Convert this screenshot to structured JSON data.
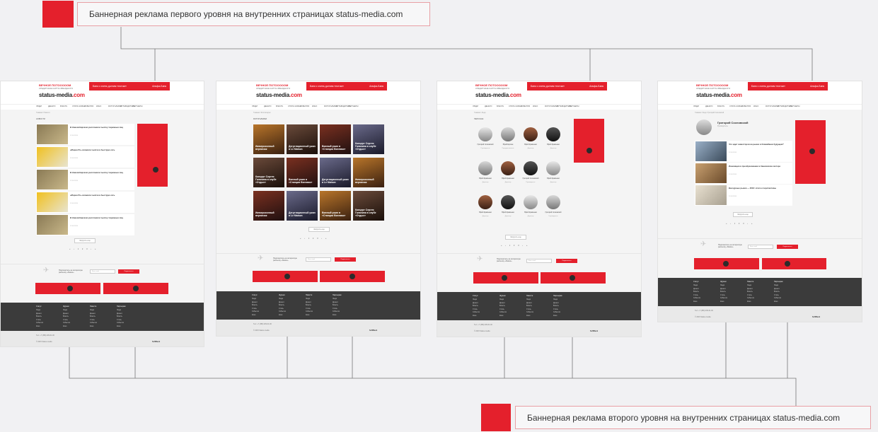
{
  "top_callout": {
    "text": "Баннерная реклама первого уровня на внутренних страницах status-media.com"
  },
  "bottom_callout": {
    "text": "Баннерная реклама второго уровня на внутренних страницах status-media.com"
  },
  "colors": {
    "accent": "#e4202c",
    "footer": "#3b3b3b",
    "background": "#f1f1f3"
  },
  "site": {
    "logo_main": "status-media",
    "logo_tld": ".com",
    "promo_line1": "ВЕЧНОЕ ПОТОООООМ",
    "promo_line2": "КРЕДИТНЫЕ КАРТЫ ЗВЕЗДНОГО",
    "banner_text": "Банк с очень долгим «потом»",
    "banner_brand": "Альфа-Банк",
    "nav": [
      "ЛЮДИ",
      "ДЕНЬГИ",
      "ВЛАСТЬ",
      "СТИЛЬ ЖИЗНИ",
      "СОБЫТИЯ",
      "КИНО",
      "ФОТОГАЛЕРЕИ",
      "ПУТЕВОДИТЕЛЬ",
      "ПАРТНЕРЫ"
    ],
    "more_button": "Загрузить еще",
    "pager": "« ‹ 1 2 3 › »",
    "subscribe_text": "Подпишитесь на интересную рассылку «Status»",
    "subscribe_placeholder": "Ваш e-mail",
    "subscribe_button": "Подписаться",
    "footer_cols": [
      "Статус",
      "Журнал",
      "Новости",
      "Партнерам"
    ],
    "footer_links": [
      "Люди",
      "Деньги",
      "Власть",
      "Стиль",
      "События",
      "Кино"
    ],
    "footer_contact": "Тел: +7 (383) 209-01-00",
    "footer_copy": "© 2015 Status-media",
    "footer_brand": "SoftBlack"
  },
  "page1": {
    "crumb": "Главная / Новости",
    "section": "НОВОСТИ",
    "news": [
      {
        "title": "В Новосибирском уничтожили тысячу тюремных лиц",
        "date": "12.03.2015"
      },
      {
        "title": "«Морин Ро» вложила тысячи в быструю сеть",
        "date": "12.03.2015"
      },
      {
        "title": "В Новосибирском уничтожили тысячу тюремных лиц",
        "date": "12.03.2015"
      },
      {
        "title": "«Морин Ро» вложила тысячи в быструю сеть",
        "date": "12.03.2015"
      },
      {
        "title": "В Новосибирском уничтожили тысячу тюремных лиц",
        "date": "12.03.2015"
      }
    ]
  },
  "page2": {
    "crumb": "Главная / Фотогалереи",
    "section": "ФОТОГАЛЕРЕИ",
    "tiles": [
      "Иммерсионный вернисаж",
      "Дегустационный ужин в Le Maison",
      "Винный ужин в «Станции Вингамо»",
      "Концерт Сергея Галанина в клубе «Отдых»",
      "Концерт Сергея Галанина в клубе «Отдых»",
      "Винный ужин в «Станции Вингамо»",
      "Дегустационный ужин в Le Maison",
      "Иммерсионный вернисаж",
      "Иммерсионный вернисаж",
      "Дегустационный ужин в Le Maison",
      "Винный ужин в «Станции Вингамо»",
      "Концерт Сергея Галанина в клубе «Отдых»"
    ]
  },
  "page3": {
    "crumb": "Главная / Люди",
    "section": "ПЕРСОНЫ",
    "people": [
      {
        "name": "Григорий Сосновский",
        "role": "Руководитель"
      },
      {
        "name": "Юрий Ерохин",
        "role": "Предприниматель"
      },
      {
        "name": "Юрий Кравченко",
        "role": "Директор"
      },
      {
        "name": "Юрий Кравченко",
        "role": "Директор"
      },
      {
        "name": "Юрий Кравченко",
        "role": "Директор"
      },
      {
        "name": "Юрий Кравченко",
        "role": "Директор"
      },
      {
        "name": "Григорий Сосновский",
        "role": "Руководитель"
      },
      {
        "name": "Юрий Кравченко",
        "role": "Директор"
      },
      {
        "name": "Юрий Кравченко",
        "role": "Директор"
      },
      {
        "name": "Юрий Кравченко",
        "role": "Директор"
      },
      {
        "name": "Юрий Кравченко",
        "role": "Директор"
      },
      {
        "name": "Григорий Сосновский",
        "role": "Руководитель"
      }
    ]
  },
  "page4": {
    "crumb": "Главная / Люди / Григорий Сосновский",
    "person_name": "Григорий Сосновский",
    "person_role": "Руководитель",
    "articles": [
      {
        "title": "Что ждет инвесторов на рынке в ближайшем будущем?",
        "date": "12.03.2015"
      },
      {
        "title": "Инновации в преобразовании в банковском секторе",
        "date": "12.03.2015"
      },
      {
        "title": "Венчурные рынки — 2016: итоги и перспективы",
        "date": "12.03.2015"
      }
    ]
  }
}
